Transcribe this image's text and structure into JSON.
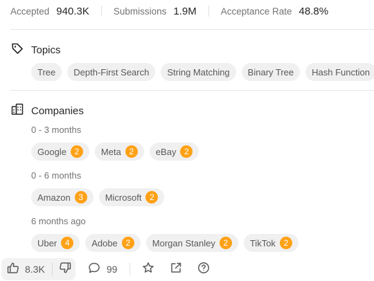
{
  "stats": [
    {
      "label": "Accepted",
      "value": "940.3K"
    },
    {
      "label": "Submissions",
      "value": "1.9M"
    },
    {
      "label": "Acceptance Rate",
      "value": "48.8%"
    }
  ],
  "topics": {
    "title": "Topics",
    "tags": [
      "Tree",
      "Depth-First Search",
      "String Matching",
      "Binary Tree",
      "Hash Function"
    ]
  },
  "companies": {
    "title": "Companies",
    "groups": [
      {
        "period": "0 - 3 months",
        "items": [
          {
            "name": "Google",
            "count": "2"
          },
          {
            "name": "Meta",
            "count": "2"
          },
          {
            "name": "eBay",
            "count": "2"
          }
        ]
      },
      {
        "period": "0 - 6 months",
        "items": [
          {
            "name": "Amazon",
            "count": "3"
          },
          {
            "name": "Microsoft",
            "count": "2"
          }
        ]
      },
      {
        "period": "6 months ago",
        "items": [
          {
            "name": "Uber",
            "count": "4"
          },
          {
            "name": "Adobe",
            "count": "2"
          },
          {
            "name": "Morgan Stanley",
            "count": "2"
          },
          {
            "name": "TikTok",
            "count": "2"
          }
        ]
      }
    ]
  },
  "actions": {
    "likes": "8.3K",
    "comments": "99",
    "icons": [
      "thumbs-up-icon",
      "thumbs-down-icon",
      "comment-icon",
      "star-icon",
      "share-icon",
      "help-icon"
    ]
  },
  "colors": {
    "badge": "#ffa116",
    "chip_bg": "#f0f0f0",
    "muted_text": "#737373"
  }
}
